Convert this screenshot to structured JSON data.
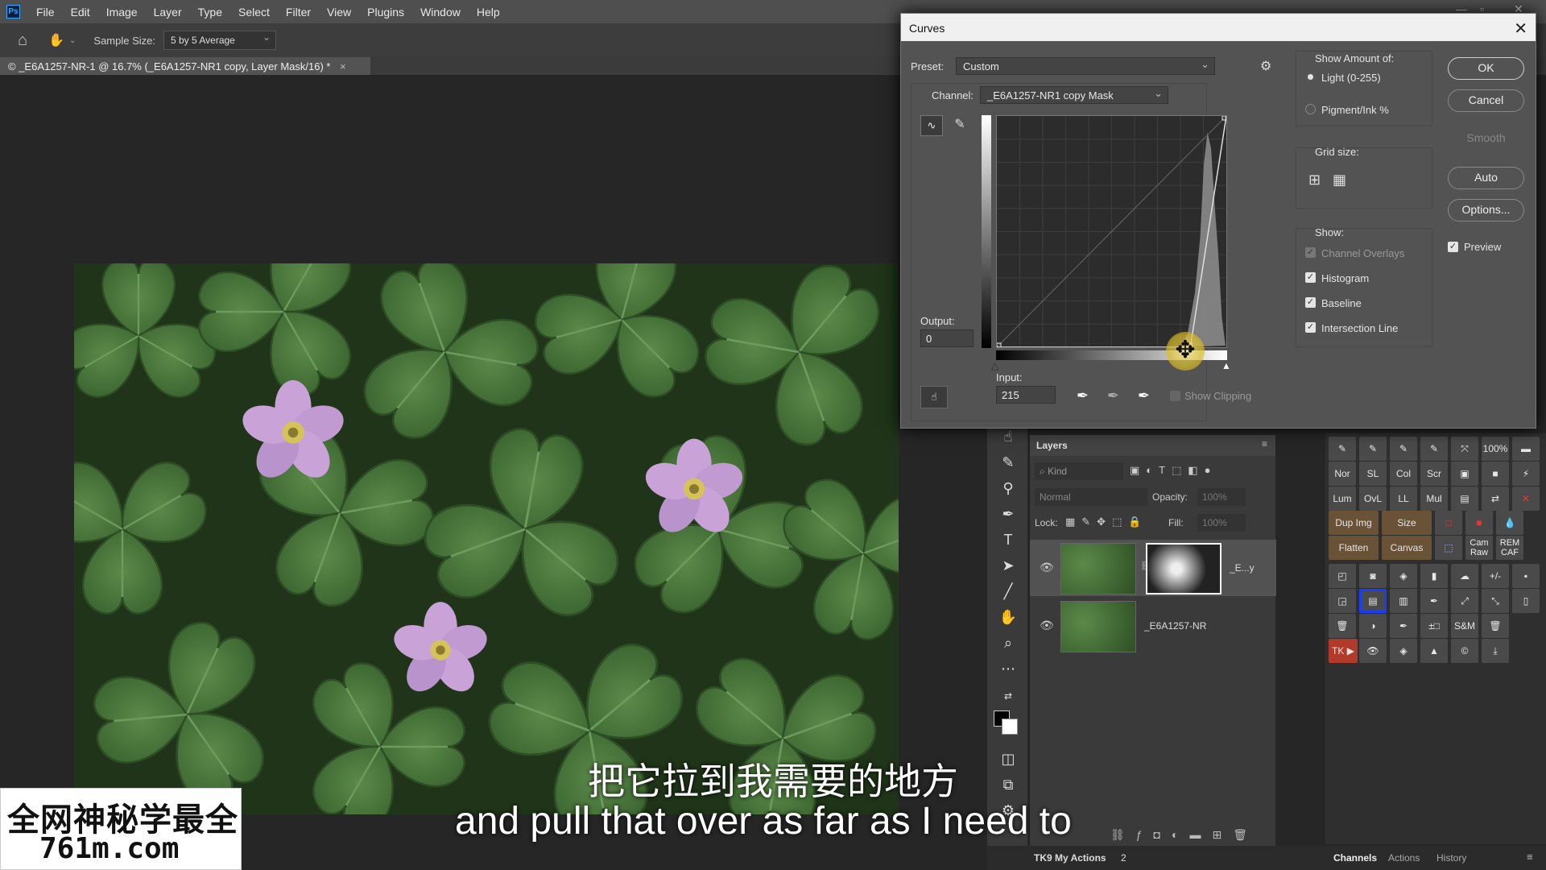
{
  "menu": {
    "logo": "Ps",
    "items": [
      "File",
      "Edit",
      "Image",
      "Layer",
      "Type",
      "Select",
      "Filter",
      "View",
      "Plugins",
      "Window",
      "Help"
    ]
  },
  "options_bar": {
    "sample_size_label": "Sample Size:",
    "sample_size_value": "5 by 5 Average"
  },
  "document_tab": {
    "title": "© _E6A1257-NR-1 @ 16.7% (_E6A1257-NR1 copy, Layer Mask/16) *",
    "close": "×"
  },
  "subtitles": {
    "chinese": "把它拉到我需要的地方",
    "english": "and pull that over as far as I need to"
  },
  "watermark": {
    "line1": "全网神秘学最全",
    "line2": "761m.com"
  },
  "curves": {
    "title": "Curves",
    "preset_label": "Preset:",
    "preset_value": "Custom",
    "channel_label": "Channel:",
    "channel_value": "_E6A1257-NR1 copy Mask",
    "output_label": "Output:",
    "output_value": "0",
    "input_label": "Input:",
    "input_value": "215",
    "show_clipping": "Show Clipping",
    "show_amount_label": "Show Amount of:",
    "light_label": "Light  (0-255)",
    "pigment_label": "Pigment/Ink %",
    "grid_size_label": "Grid size:",
    "show_label": "Show:",
    "checks": {
      "channel_overlays": "Channel Overlays",
      "histogram": "Histogram",
      "baseline": "Baseline",
      "intersection_line": "Intersection Line"
    },
    "buttons": {
      "ok": "OK",
      "cancel": "Cancel",
      "smooth": "Smooth",
      "auto": "Auto",
      "options": "Options..."
    },
    "preview_label": "Preview",
    "curve_points": [
      [
        0,
        0
      ],
      [
        215,
        0
      ],
      [
        255,
        255
      ]
    ]
  },
  "layers": {
    "title": "Layers",
    "kind_placeholder": "Kind",
    "blend_mode": "Normal",
    "opacity_label": "Opacity:",
    "opacity_value": "100%",
    "lock_label": "Lock:",
    "fill_label": "Fill:",
    "fill_value": "100%",
    "rows": [
      {
        "name": "_E...y"
      },
      {
        "name": "_E6A1257-NR"
      }
    ]
  },
  "actions": {
    "buttons": [
      "100%",
      "Nor",
      "SL",
      "Col",
      "Scr",
      "Lum",
      "OvL",
      "LL",
      "Mul",
      "Dup Img",
      "Size",
      "Flatten",
      "Canvas",
      "Cam Raw",
      "REM CAF",
      "+/-",
      "±□",
      "S&M",
      "TK ▶"
    ]
  },
  "bottom": {
    "actions_tab": "TK9 My Actions",
    "actions_count": "2",
    "tabs": [
      "Channels",
      "Actions",
      "History"
    ]
  }
}
